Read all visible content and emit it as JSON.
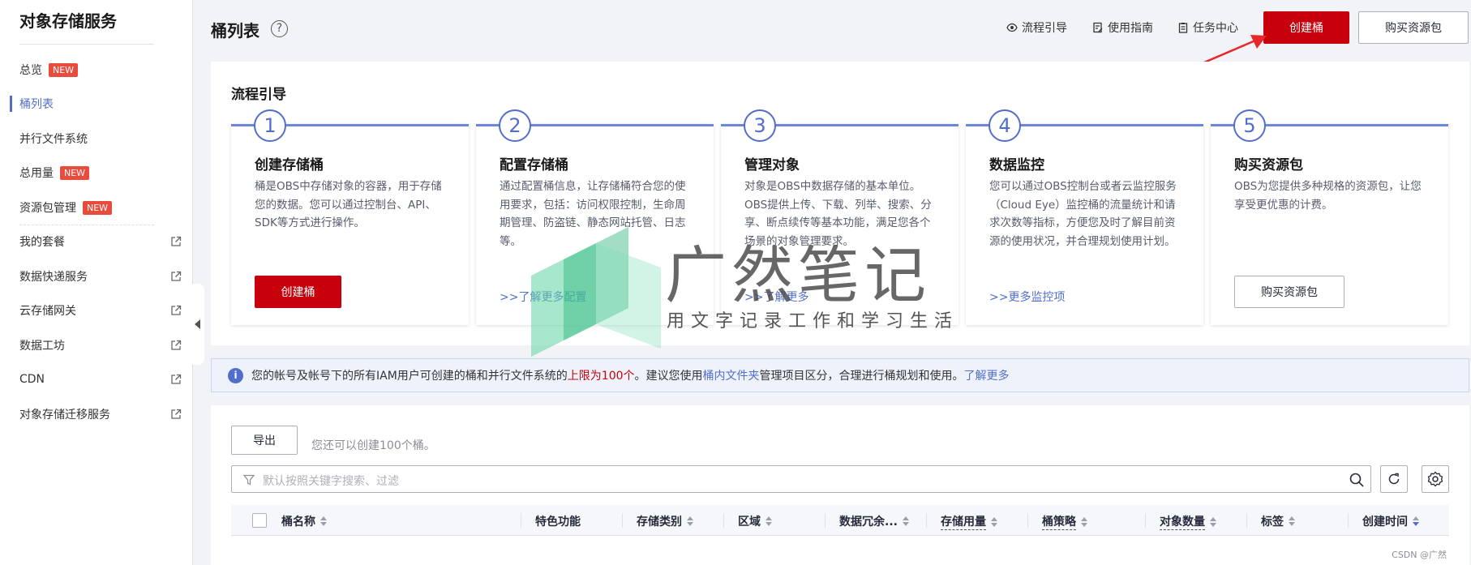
{
  "sidebar": {
    "title": "对象存储服务",
    "items": [
      {
        "label": "总览",
        "badge": "NEW",
        "external": false
      },
      {
        "label": "桶列表",
        "badge": "",
        "external": false,
        "active": true
      },
      {
        "label": "并行文件系统",
        "badge": "",
        "external": false
      },
      {
        "label": "总用量",
        "badge": "NEW",
        "external": false
      },
      {
        "label": "资源包管理",
        "badge": "NEW",
        "external": false
      },
      {
        "label": "我的套餐",
        "badge": "",
        "external": true
      },
      {
        "label": "数据快递服务",
        "badge": "",
        "external": true
      },
      {
        "label": "云存储网关",
        "badge": "",
        "external": true
      },
      {
        "label": "数据工坊",
        "badge": "",
        "external": true
      },
      {
        "label": "CDN",
        "badge": "",
        "external": true
      },
      {
        "label": "对象存储迁移服务",
        "badge": "",
        "external": true
      }
    ]
  },
  "header": {
    "title": "桶列表",
    "help": "?",
    "links": [
      "流程引导",
      "使用指南",
      "任务中心"
    ],
    "create_button": "创建桶",
    "buy_button": "购买资源包"
  },
  "guide": {
    "title": "流程引导",
    "steps": [
      {
        "num": "1",
        "name": "创建存储桶",
        "desc": "桶是OBS中存储对象的容器，用于存储您的数据。您可以通过控制台、API、SDK等方式进行操作。",
        "button": "创建桶"
      },
      {
        "num": "2",
        "name": "配置存储桶",
        "desc": "通过配置桶信息，让存储桶符合您的使用要求，包括：访问权限控制，生命周期管理、防盗链、静态网站托管、日志等。",
        "link": ">>了解更多配置"
      },
      {
        "num": "3",
        "name": "管理对象",
        "desc": "对象是OBS中数据存储的基本单位。OBS提供上传、下载、列举、搜索、分享、断点续传等基本功能，满足您各个场景的对象管理要求。",
        "link": ">>了解更多"
      },
      {
        "num": "4",
        "name": "数据监控",
        "desc": "您可以通过OBS控制台或者云监控服务（Cloud Eye）监控桶的流量统计和请求次数等指标，方便您及时了解目前资源的使用状况，并合理规划使用计划。",
        "link": ">>更多监控项"
      },
      {
        "num": "5",
        "name": "购买资源包",
        "desc": "OBS为您提供多种规格的资源包，让您享受更优惠的计费。",
        "button": "购买资源包"
      }
    ]
  },
  "watermark": {
    "title": "广然笔记",
    "subtitle": "用文字记录工作和学习生活"
  },
  "info": {
    "part1": "您的帐号及帐号下的所有IAM用户可创建的桶和并行文件系统的",
    "highlight": "上限为100个",
    "part2": "。建议您使用",
    "folder_link": "桶内文件夹",
    "part3": "管理项目区分，合理进行桶规划和使用。",
    "more_link": "了解更多"
  },
  "list": {
    "export_button": "导出",
    "hint": "您还可以创建100个桶。",
    "search_placeholder": "默认按照关键字搜索、过滤",
    "columns": [
      "桶名称",
      "特色功能",
      "存储类别",
      "区域",
      "数据冗余...",
      "存储用量",
      "桶策略",
      "对象数量",
      "标签",
      "创建时间"
    ]
  },
  "footer": {
    "credit": "CSDN @广然"
  },
  "colors": {
    "accent": "#526ecc",
    "brand_red": "#c7000b",
    "badge": "#e84c3d"
  }
}
